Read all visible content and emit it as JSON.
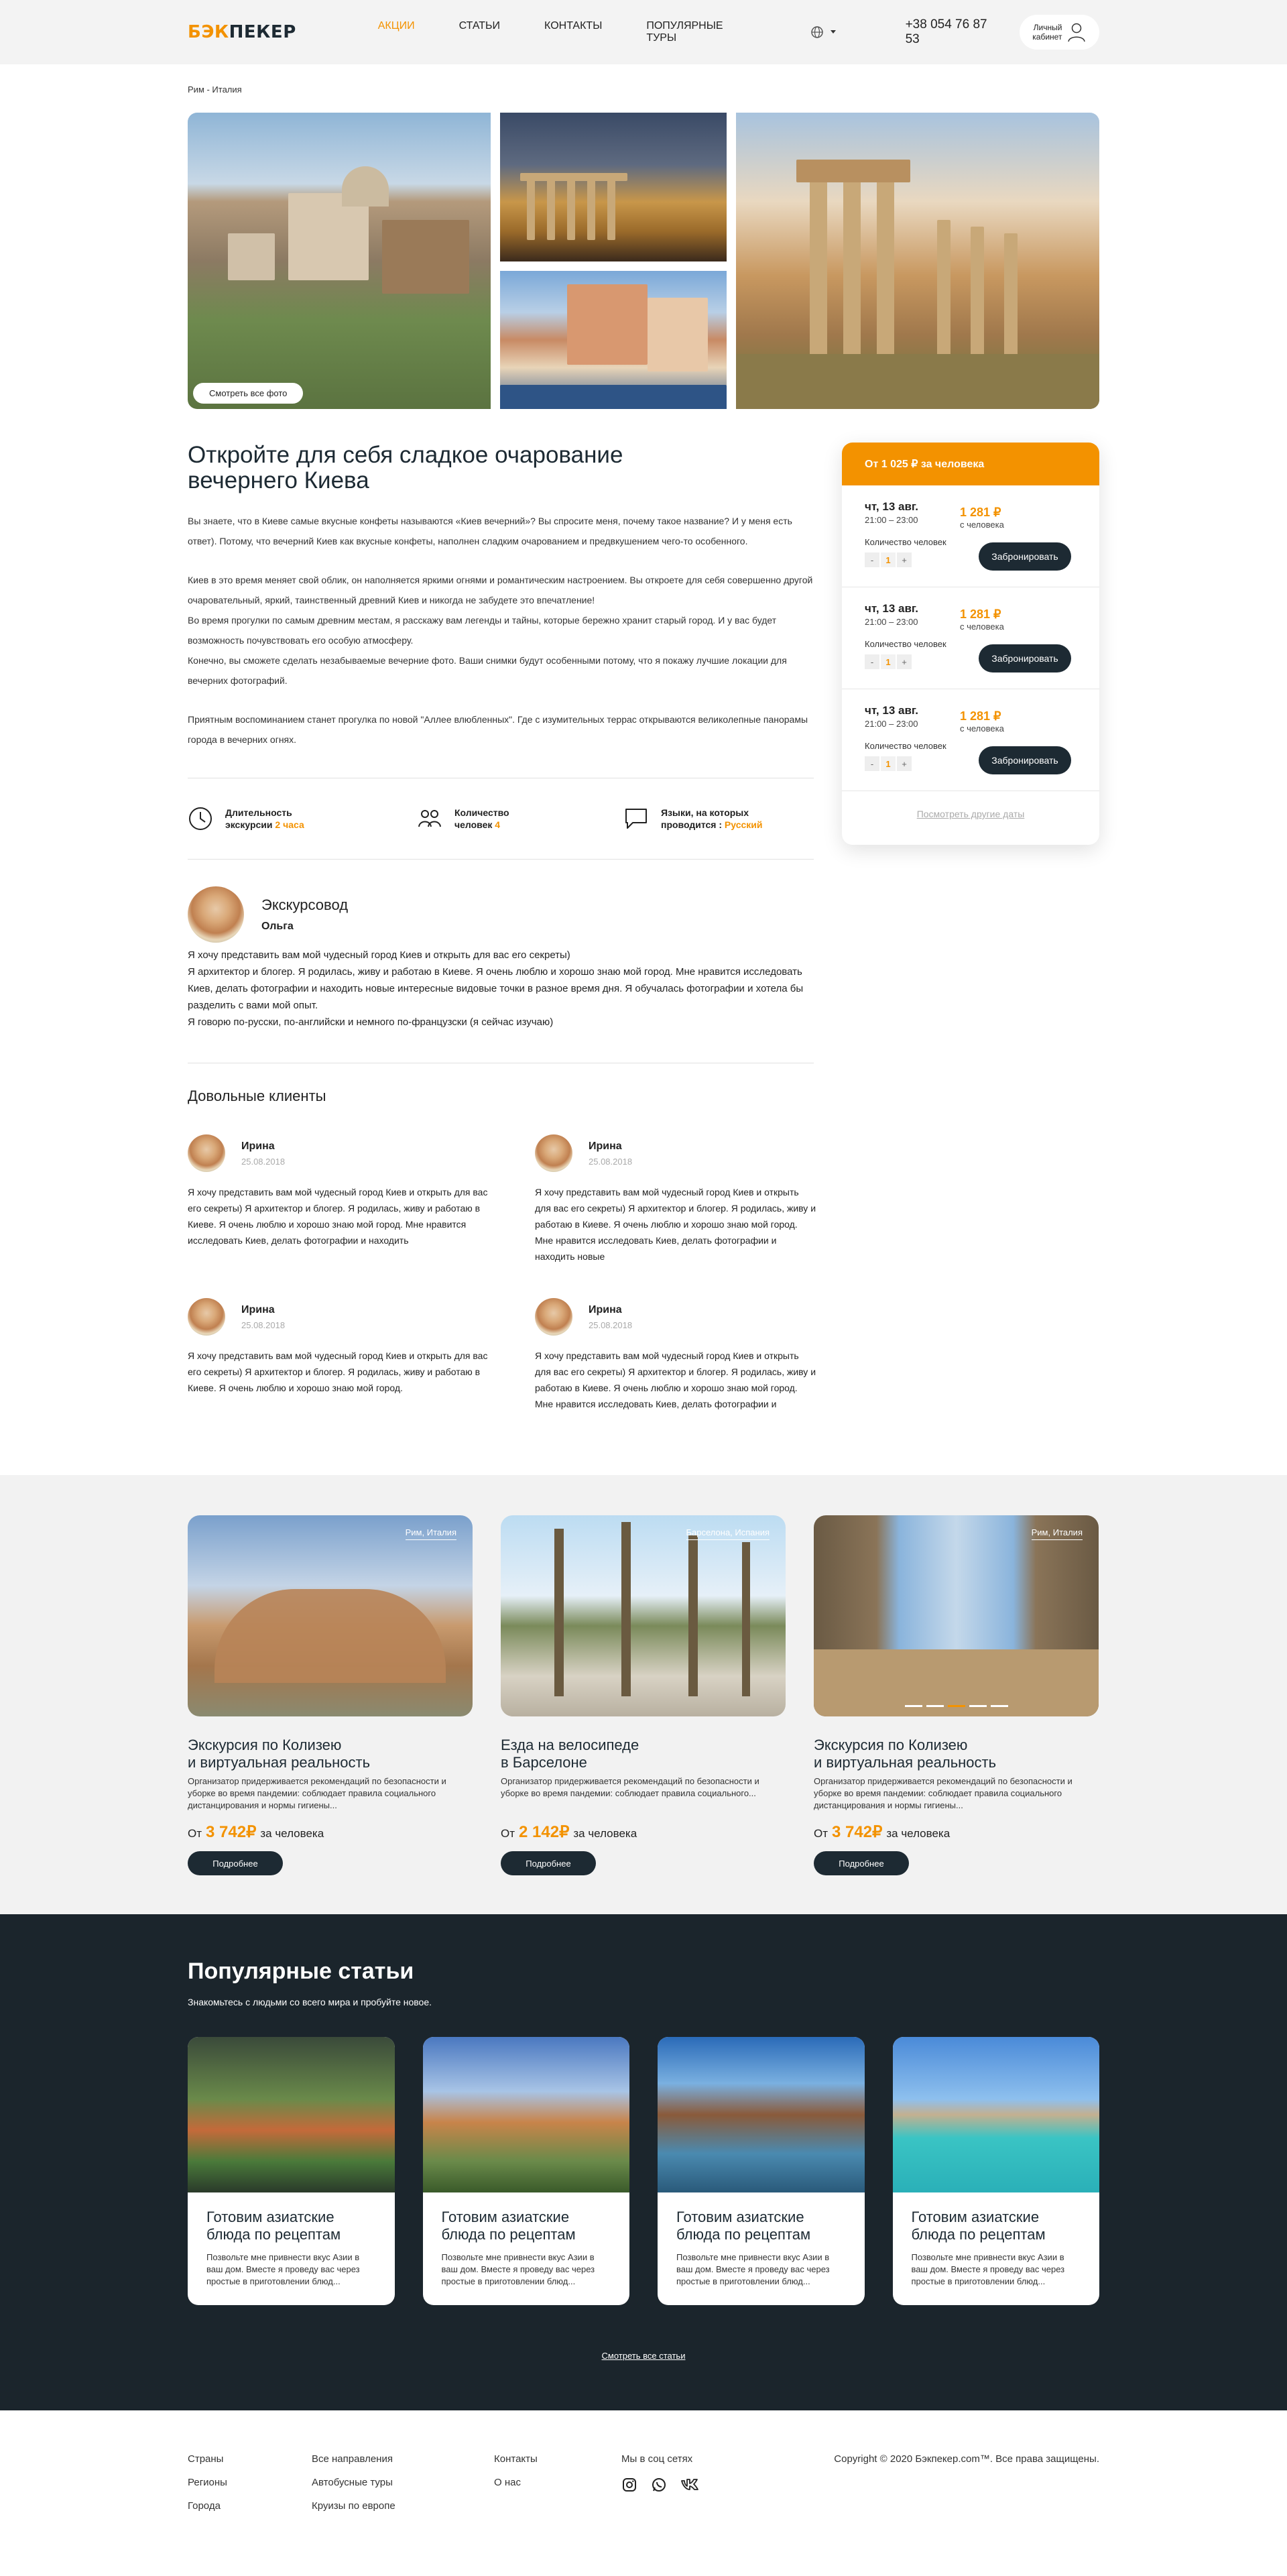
{
  "header": {
    "logo_part1": "БЭК",
    "logo_part2": "ПЕКЕР",
    "nav": [
      "АКЦИИ",
      "СТАТЬИ",
      "КОНТАКТЫ",
      "ПОПУЛЯРНЫЕ ТУРЫ"
    ],
    "phone": "+38 054 76 87 53",
    "cabinet_line1": "Личный",
    "cabinet_line2": "кабинет"
  },
  "breadcrumb": "Рим - Италия",
  "gallery": {
    "show_photos": "Смотреть все фото"
  },
  "tour": {
    "title_line1": "Откройте для себя сладкое очарование",
    "title_line2": "вечернего Киева",
    "p1": "Вы знаете, что в Киеве самые вкусные конфеты называются «Киев вечерний»? Вы спросите меня, почему такое название? И у меня есть ответ). Потому, что вечерний Киев как вкусные конфеты, наполнен сладким очарованием и предвкушением чего-то особенного.",
    "p2": "Киев в это время меняет свой облик, он наполняется яркими огнями и романтическим настроением. Вы откроете для себя совершенно другой очаровательный, яркий, таинственный древний Киев и никогда не забудете это впечатление!",
    "p3": "Во время прогулки по самым древним местам, я расскажу вам легенды и тайны, которые бережно хранит старый город. И у вас будет возможность почувствовать его особую атмосферу.",
    "p4": "Конечно, вы сможете сделать незабываемые вечерние фото. Ваши снимки будут особенными потому, что я покажу лучшие локации для вечерних фотографий.",
    "p5": "Приятным воспоминанием станет прогулка по новой \"Аллее влюбленных\". Где с изумительных террас открываются великолепные панорамы города в вечерних огнях."
  },
  "info": {
    "duration_label1": "Длительность",
    "duration_label2": "экскурсии",
    "duration_value": "2 часа",
    "people_label1": "Количество",
    "people_label2": "человек",
    "people_value": "4",
    "lang_label1": "Языки, на которых",
    "lang_label2": "проводится :",
    "lang_value": "Русский"
  },
  "guide": {
    "role": "Экскурсовод",
    "name": "Ольга",
    "text1": "Я хочу представить вам мой чудесный город Киев и открыть для вас его секреты)",
    "text2": "Я архитектор и блогер. Я родилась, живу и работаю в Киеве. Я очень люблю и хорошо знаю мой город. Мне нравится исследовать Киев, делать фотографии и находить новые интересные видовые точки в разное время дня. Я обучалась фотографии и хотела бы разделить с вами мой опыт.",
    "text3": "Я говорю по-русски, по-английски и немного по-французски (я сейчас изучаю)"
  },
  "clients": {
    "title": "Довольные клиенты",
    "reviews": [
      {
        "name": "Ирина",
        "date": "25.08.2018",
        "text": "Я хочу представить вам мой чудесный город Киев и открыть для вас его секреты) Я архитектор и блогер. Я родилась, живу и работаю в Киеве. Я очень люблю и хорошо знаю мой город. Мне нравится исследовать Киев, делать фотографии и находить"
      },
      {
        "name": "Ирина",
        "date": "25.08.2018",
        "text": "Я хочу представить вам мой чудесный город Киев и открыть для вас его секреты) Я архитектор и блогер. Я родилась, живу и работаю в Киеве. Я очень люблю и хорошо знаю мой город. Мне нравится исследовать Киев, делать фотографии и находить новые"
      },
      {
        "name": "Ирина",
        "date": "25.08.2018",
        "text": "Я хочу представить вам мой чудесный город Киев и открыть для вас его секреты) Я архитектор и блогер. Я родилась, живу и работаю в Киеве. Я очень люблю и хорошо знаю мой город."
      },
      {
        "name": "Ирина",
        "date": "25.08.2018",
        "text": "Я хочу представить вам мой чудесный город Киев и открыть для вас его секреты) Я архитектор и блогер. Я родилась, живу и работаю в Киеве. Я очень люблю и хорошо знаю мой город. Мне нравится исследовать Киев, делать фотографии и"
      }
    ]
  },
  "booking": {
    "header": "От 1 025 ₽ за человека",
    "slots": [
      {
        "date": "чт, 13 авг.",
        "time": "21:00 – 23:00",
        "price": "1 281 ₽",
        "unit": "с человека",
        "count_label": "Количество человек",
        "count": "1",
        "button": "Забронировать"
      },
      {
        "date": "чт, 13 авг.",
        "time": "21:00 – 23:00",
        "price": "1 281 ₽",
        "unit": "с человека",
        "count_label": "Количество человек",
        "count": "1",
        "button": "Забронировать"
      },
      {
        "date": "чт, 13 авг.",
        "time": "21:00 – 23:00",
        "price": "1 281 ₽",
        "unit": "с человека",
        "count_label": "Количество человек",
        "count": "1",
        "button": "Забронировать"
      }
    ],
    "minus": "-",
    "plus": "+",
    "other_dates": "Посмотреть другие даты"
  },
  "tours": [
    {
      "tag": "Рим, Италия",
      "title_line1": "Экскурсия по Колизею",
      "title_line2": "и виртуальная реальность",
      "desc": "Организатор придерживается рекомендаций по безопасности и уборке во время пандемии: соблюдает правила социального дистанцирования и нормы гигиены...",
      "from": "От",
      "price": "3 742₽",
      "unit": "за человека",
      "button": "Подробнее"
    },
    {
      "tag": "Барселона, Испания",
      "title_line1": "Езда на велосипеде",
      "title_line2": "в Барселоне",
      "desc": "Организатор придерживается рекомендаций по безопасности и уборке во время пандемии: соблюдает правила социального...",
      "from": "От",
      "price": "2 142₽",
      "unit": "за человека",
      "button": "Подробнее"
    },
    {
      "tag": "Рим, Италия",
      "title_line1": "Экскурсия по Колизею",
      "title_line2": "и виртуальная реальность",
      "desc": "Организатор придерживается рекомендаций по безопасности и уборке во время пандемии: соблюдает правила социального дистанцирования и нормы гигиены...",
      "from": "От",
      "price": "3 742₽",
      "unit": "за человека",
      "button": "Подробнее"
    }
  ],
  "articles": {
    "title": "Популярные статьи",
    "subtitle": "Знакомьтесь с людьми со всего мира и пробуйте новое.",
    "items": [
      {
        "title_line1": "Готовим азиатские",
        "title_line2": "блюда по рецептам",
        "desc": "Позвольте мне привнести вкус Азии в ваш дом. Вместе я проведу вас через простые в приготовлении блюд..."
      },
      {
        "title_line1": "Готовим азиатские",
        "title_line2": "блюда по рецептам",
        "desc": "Позвольте мне привнести вкус Азии в ваш дом. Вместе я проведу вас через простые в приготовлении блюд..."
      },
      {
        "title_line1": "Готовим азиатские",
        "title_line2": "блюда по рецептам",
        "desc": "Позвольте мне привнести вкус Азии в ваш дом. Вместе я проведу вас через простые в приготовлении блюд..."
      },
      {
        "title_line1": "Готовим азиатские",
        "title_line2": "блюда по рецептам",
        "desc": "Позвольте мне привнести вкус Азии в ваш дом. Вместе я проведу вас через простые в приготовлении блюд..."
      }
    ],
    "see_all": "Смотреть все статьи"
  },
  "footer": {
    "col1": [
      "Страны",
      "Регионы",
      "Города"
    ],
    "col2": [
      "Все направления",
      "Автобусные туры",
      "Круизы по европе"
    ],
    "col3": [
      "Контакты",
      "О нас"
    ],
    "social_title": "Мы в соц сетях",
    "copyright": "Copyright © 2020 Бэкпекер.com™. Все права защищены."
  },
  "colors": {
    "accent": "#f39200",
    "dark": "#1b252c"
  }
}
